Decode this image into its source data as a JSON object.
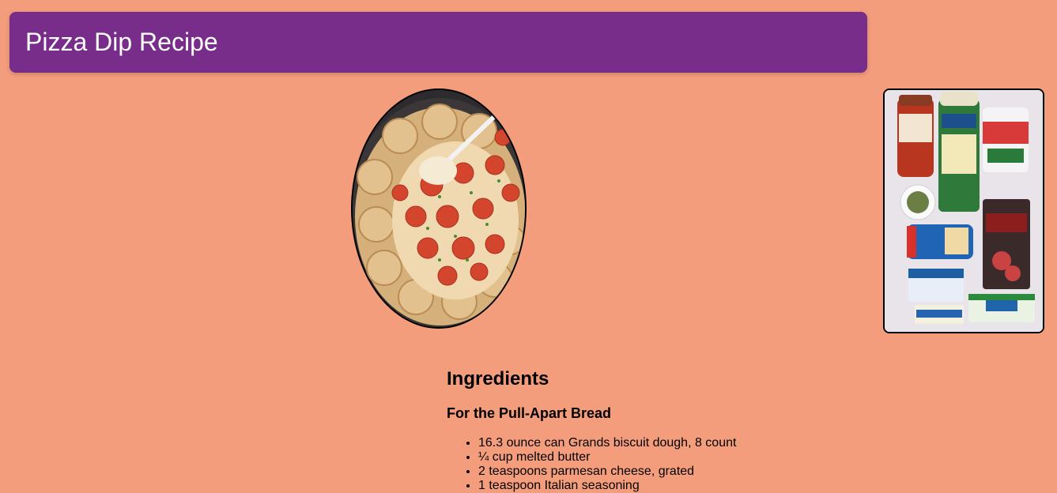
{
  "header": {
    "title": "Pizza Dip Recipe"
  },
  "images": {
    "hero": "pizza-dip-skillet-photo",
    "side": "ingredients-overhead-photo"
  },
  "ingredients": {
    "heading": "Ingredients",
    "sections": [
      {
        "title": "For the Pull-Apart Bread",
        "items": [
          "16.3 ounce can Grands biscuit dough, 8 count",
          "¼ cup melted butter",
          "2 teaspoons parmesan cheese, grated",
          "1 teaspoon Italian seasoning"
        ]
      }
    ]
  },
  "colors": {
    "background": "#F49D7D",
    "header": "#782D8A",
    "header_text": "#FFFFFF"
  }
}
